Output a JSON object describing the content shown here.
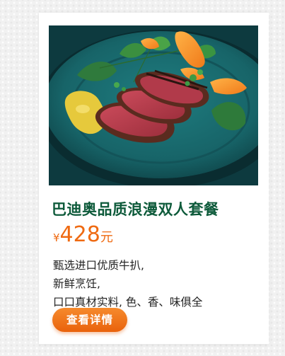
{
  "product": {
    "title": "巴迪奥品质浪漫双人套餐",
    "price_symbol": "¥",
    "price_value": "428",
    "price_unit": "元",
    "description_lines": [
      "甄选进口优质牛扒,",
      "新鲜烹饪,",
      "口口真材实料, 色、香、味俱全"
    ],
    "detail_button_label": "查看详情",
    "accent_color": "#ef6a12",
    "title_color": "#0d5a3a"
  }
}
